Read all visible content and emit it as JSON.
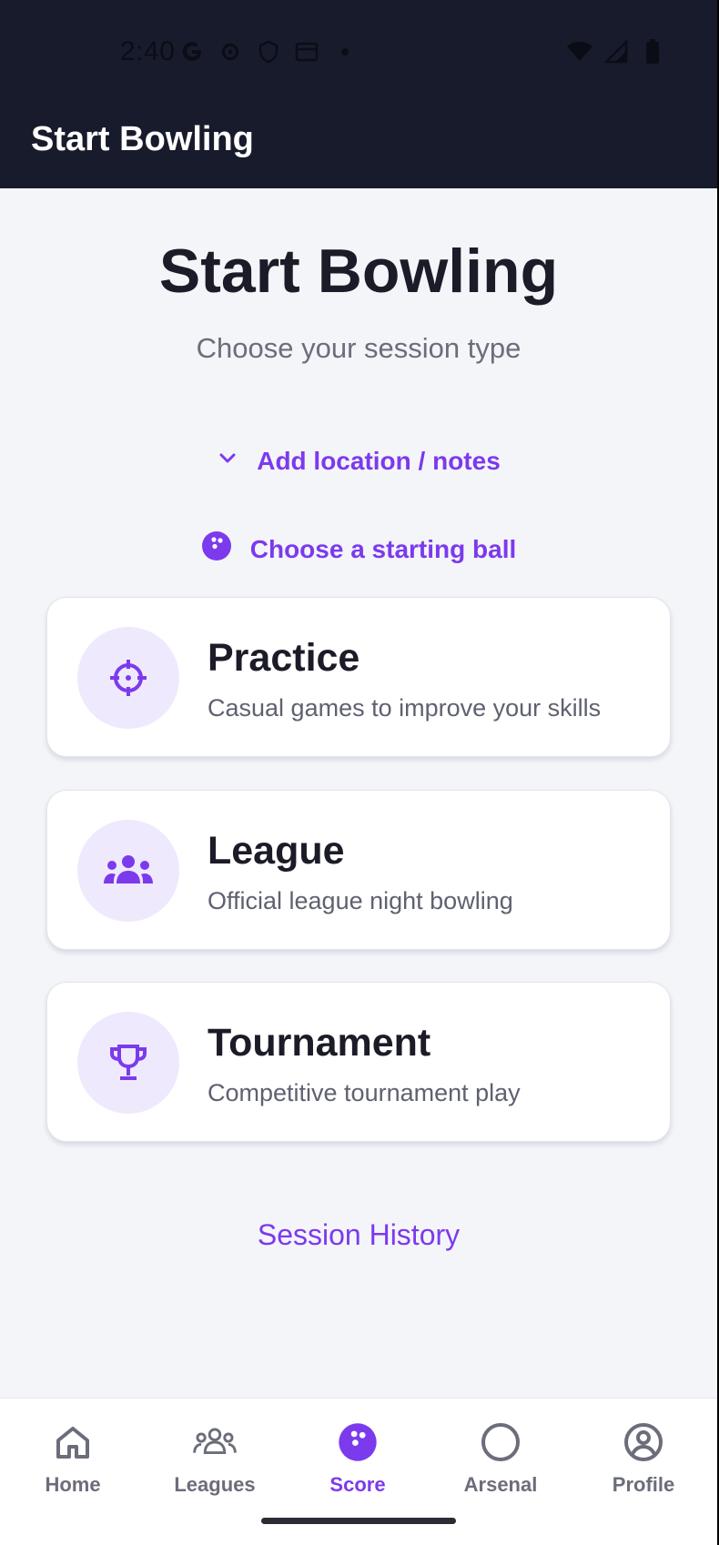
{
  "status_bar": {
    "time": "2:40",
    "icons_left": [
      "google-icon",
      "gear-icon",
      "shield-icon",
      "calendar-icon",
      "dot-icon"
    ],
    "icons_right": [
      "wifi-icon",
      "signal-icon",
      "battery-icon"
    ]
  },
  "app_bar": {
    "title": "Start Bowling"
  },
  "hero": {
    "title": "Start Bowling",
    "subtitle": "Choose your session type"
  },
  "options": {
    "location_link": "Add location / notes",
    "ball_link": "Choose a starting ball"
  },
  "session_types": [
    {
      "title": "Practice",
      "description": "Casual games to improve your skills",
      "icon": "crosshair-icon"
    },
    {
      "title": "League",
      "description": "Official league night bowling",
      "icon": "group-icon"
    },
    {
      "title": "Tournament",
      "description": "Competitive tournament play",
      "icon": "trophy-icon"
    }
  ],
  "session_history_link": "Session History",
  "bottom_nav": {
    "items": [
      {
        "label": "Home",
        "icon": "home-icon",
        "active": false
      },
      {
        "label": "Leagues",
        "icon": "leagues-icon",
        "active": false
      },
      {
        "label": "Score",
        "icon": "bowling-ball-icon",
        "active": true
      },
      {
        "label": "Arsenal",
        "icon": "circle-icon",
        "active": false
      },
      {
        "label": "Profile",
        "icon": "profile-icon",
        "active": false
      }
    ]
  },
  "colors": {
    "accent": "#7c3aed",
    "app_bar": "#181b2c",
    "background": "#f4f5f9",
    "icon_bg": "#efe9fe",
    "inactive": "#6b6d7a"
  }
}
